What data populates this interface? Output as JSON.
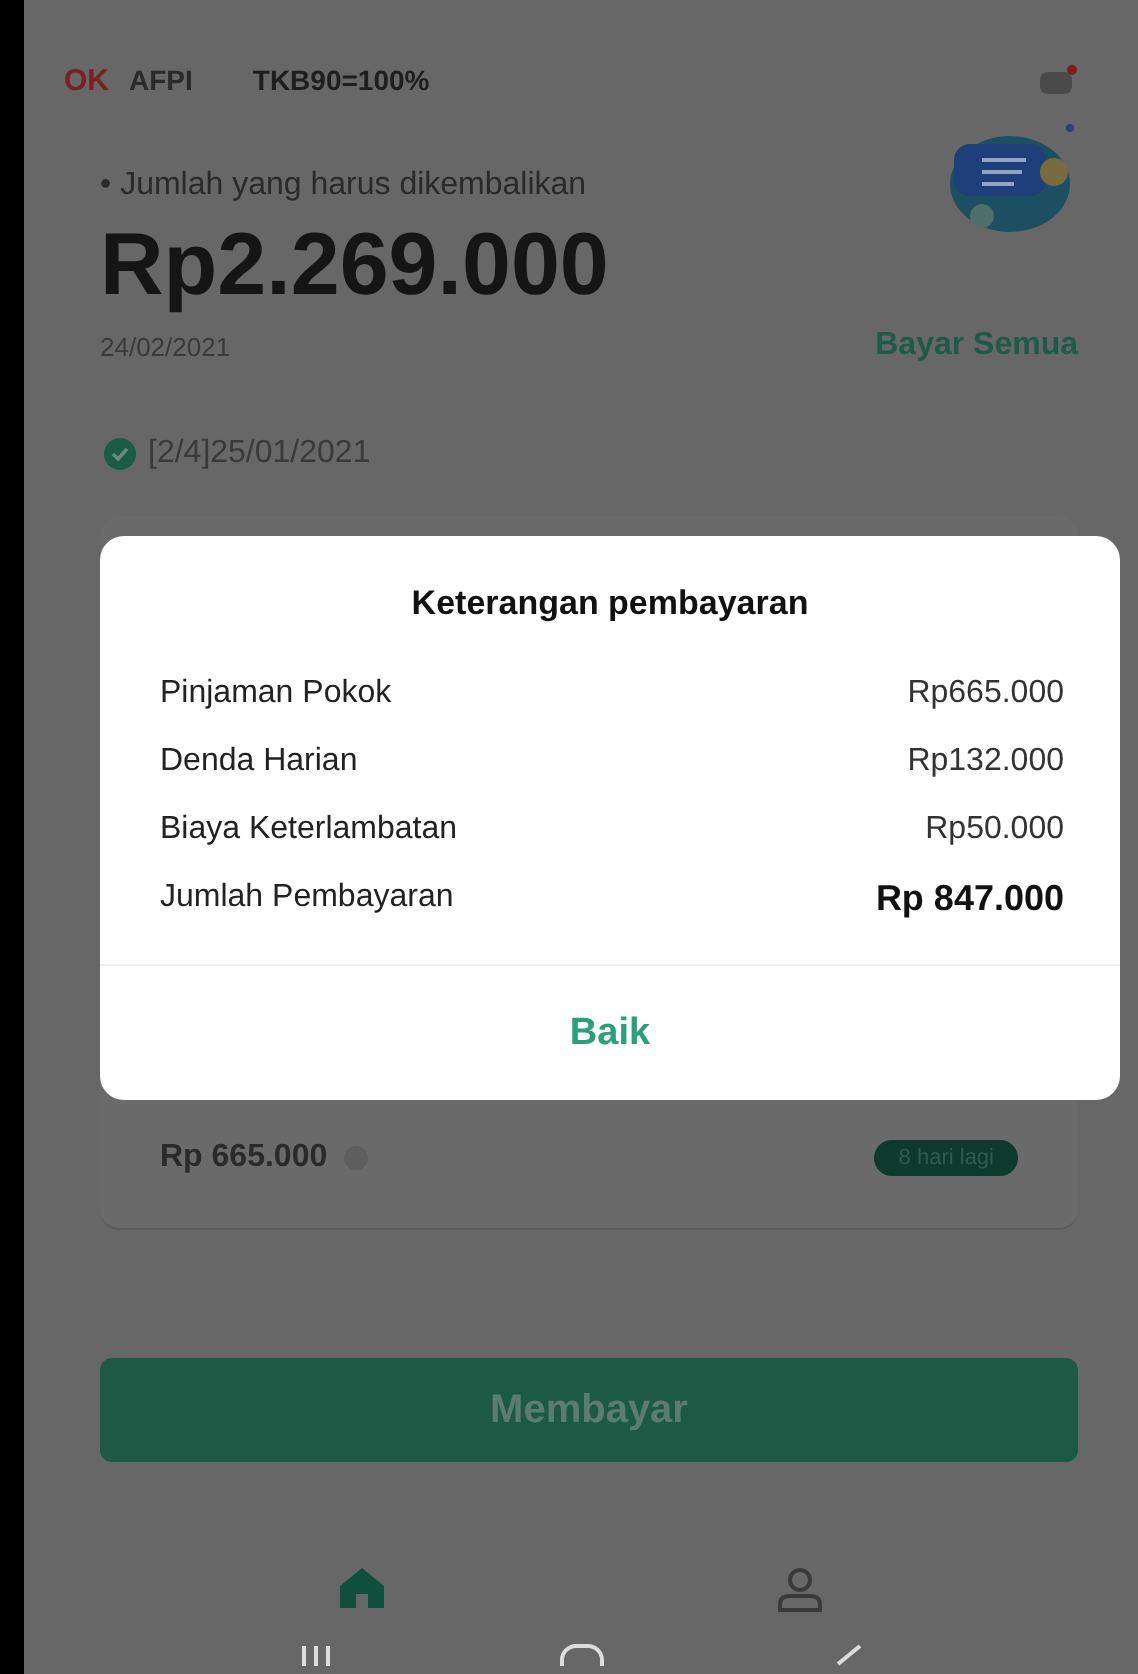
{
  "header": {
    "logos": [
      "OK",
      "AFPI"
    ],
    "tkb": "TKB90=100%"
  },
  "summary": {
    "bullet": "•",
    "label": "Jumlah yang harus dikembalikan",
    "amount": "Rp2.269.000",
    "date": "24/02/2021",
    "pay_all": "Bayar Semua"
  },
  "installment": {
    "paid": true,
    "title": "[2/4]25/01/2021",
    "amount": "Rp 665.000",
    "badge": "8 hari lagi"
  },
  "dialog": {
    "title": "Keterangan pembayaran",
    "rows": [
      {
        "label": "Pinjaman Pokok",
        "value": "Rp665.000",
        "kind": "item"
      },
      {
        "label": "Denda Harian",
        "value": "Rp132.000",
        "kind": "item"
      },
      {
        "label": "Biaya Keterlambatan",
        "value": "Rp50.000",
        "kind": "item"
      },
      {
        "label": "Jumlah Pembayaran",
        "value": "Rp 847.000",
        "kind": "total"
      }
    ],
    "button": "Baik"
  },
  "pay_button": "Membayar",
  "bottom_nav": [
    {
      "kind": "home",
      "selected": true
    },
    {
      "kind": "profile",
      "selected": false
    }
  ]
}
